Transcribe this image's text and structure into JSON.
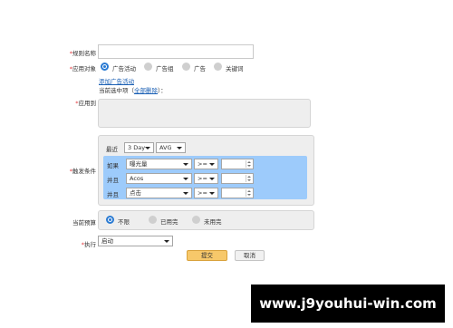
{
  "form": {
    "rule_name_label": "规则名称",
    "apply_object_label": "应用对象",
    "apply_objects": [
      "广告活动",
      "广告组",
      "广告",
      "关键词"
    ],
    "add_campaign_link": "添加广告活动",
    "selected_prefix": "当前选中项（",
    "clear_all_link": "全部删除",
    "selected_suffix": "）：",
    "apply_to_label": "应用到",
    "trigger_label": "触发条件",
    "recent_label": "最近",
    "period_value": "3 Day",
    "agg_value": "AVG",
    "conditions": [
      {
        "connector": "如果",
        "metric": "曝光量",
        "operator": ">="
      },
      {
        "connector": "并且",
        "metric": "Acos",
        "operator": ">="
      },
      {
        "connector": "并且",
        "metric": "点击",
        "operator": ">="
      }
    ],
    "budget_label": "当前预算",
    "budget_options": [
      "不限",
      "已用完",
      "未用完"
    ],
    "execute_label": "执行",
    "execute_value": "启动",
    "submit_label": "提交",
    "cancel_label": "取消"
  },
  "colors": {
    "accent": "#2a7bd3",
    "required": "#e4393c",
    "condition_bg": "#9dcbfb",
    "submit_bg": "#f7c86a"
  },
  "watermark": "www.j9youhui-win.com"
}
